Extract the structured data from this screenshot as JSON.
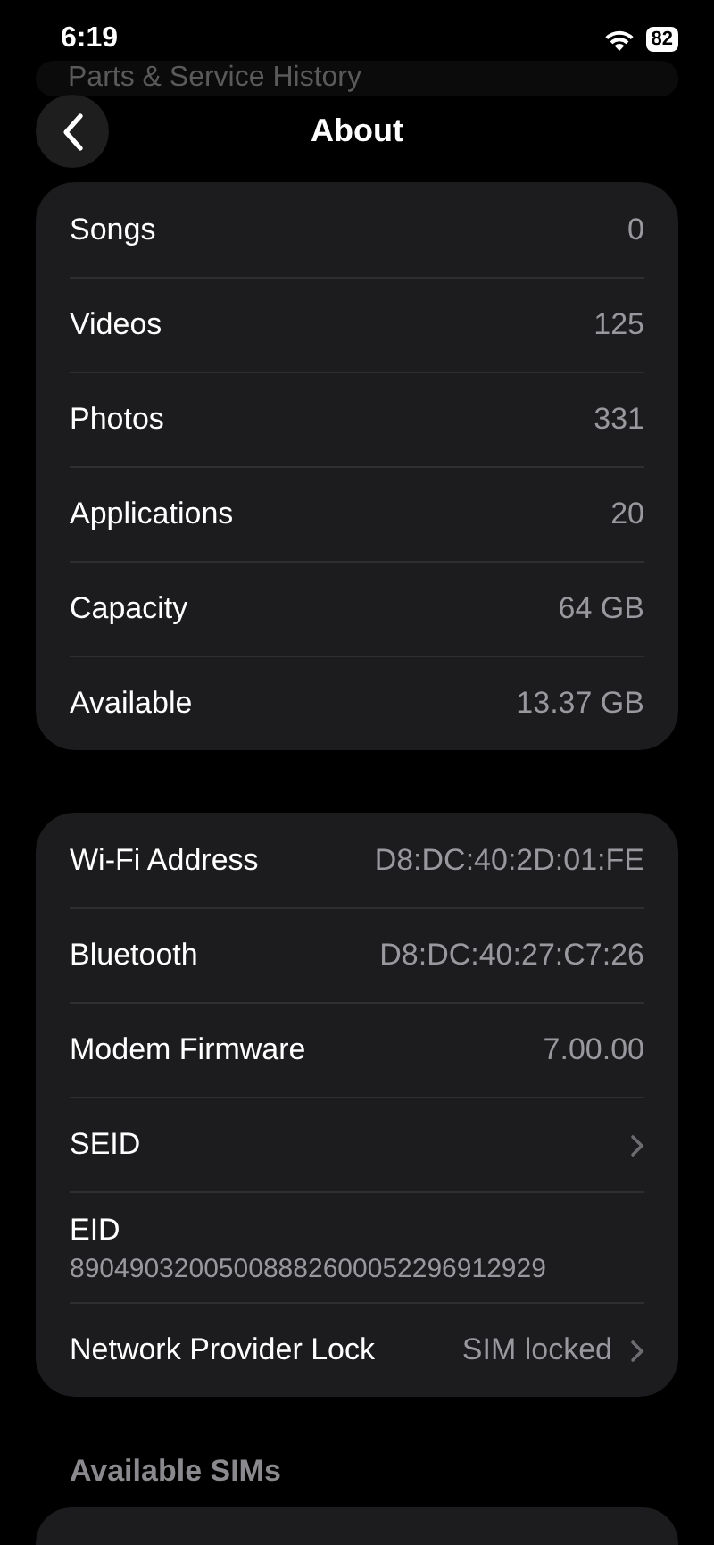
{
  "status_bar": {
    "time": "6:19",
    "battery": "82"
  },
  "background_card": {
    "title": "Parts & Service History"
  },
  "nav": {
    "title": "About"
  },
  "groups": [
    {
      "rows": [
        {
          "kind": "value",
          "label": "Songs",
          "value": "0"
        },
        {
          "kind": "value",
          "label": "Videos",
          "value": "125"
        },
        {
          "kind": "value",
          "label": "Photos",
          "value": "331"
        },
        {
          "kind": "value",
          "label": "Applications",
          "value": "20"
        },
        {
          "kind": "value",
          "label": "Capacity",
          "value": "64 GB"
        },
        {
          "kind": "value",
          "label": "Available",
          "value": "13.37 GB"
        }
      ]
    },
    {
      "rows": [
        {
          "kind": "value",
          "label": "Wi-Fi Address",
          "value": "D8:DC:40:2D:01:FE"
        },
        {
          "kind": "value",
          "label": "Bluetooth",
          "value": "D8:DC:40:27:C7:26"
        },
        {
          "kind": "value",
          "label": "Modem Firmware",
          "value": "7.00.00"
        },
        {
          "kind": "link",
          "label": "SEID"
        },
        {
          "kind": "stacked",
          "label": "EID",
          "value": "89049032005008882600052296912929"
        },
        {
          "kind": "link",
          "label": "Network Provider Lock",
          "value": "SIM locked"
        }
      ]
    }
  ],
  "section_header": "Available SIMs"
}
